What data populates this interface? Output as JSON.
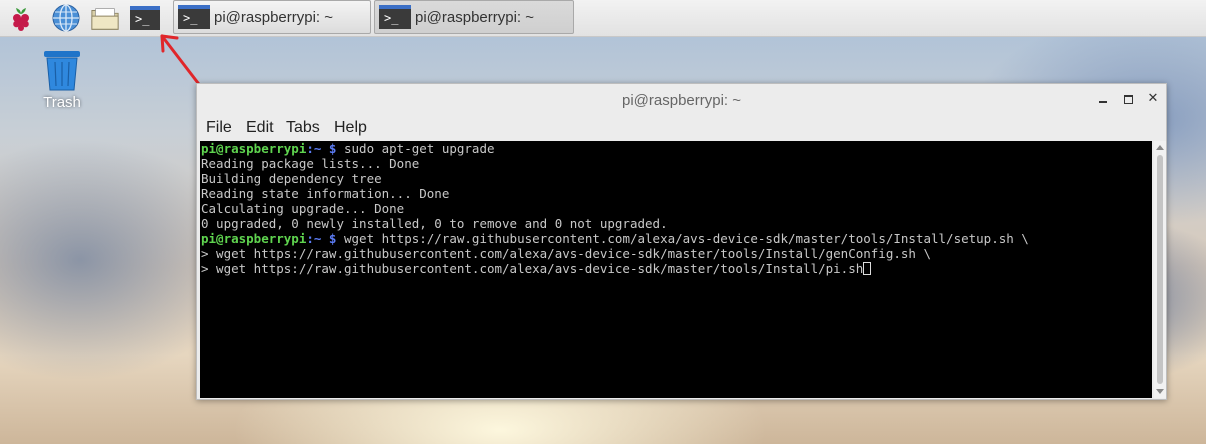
{
  "taskbar": {
    "icons": [
      "raspberry-menu-icon",
      "web-browser-icon",
      "file-manager-icon",
      "terminal-launcher-icon"
    ],
    "terminal_glyph": ">_",
    "windows": [
      {
        "label": "pi@raspberrypi: ~"
      },
      {
        "label": "pi@raspberrypi: ~"
      }
    ]
  },
  "desktop": {
    "trash_label": "Trash",
    "annotation": "red-arrow-pointing-to-terminal-launcher"
  },
  "window": {
    "title": "pi@raspberrypi: ~",
    "controls": {
      "minimize": "‗",
      "maximize": "▫",
      "close": "✕"
    },
    "menu": [
      "File",
      "Edit",
      "Tabs",
      "Help"
    ]
  },
  "terminal": {
    "prompt_user": "pi@raspberrypi",
    "prompt_path": ":~ $",
    "lines": [
      {
        "type": "prompt",
        "text": " sudo apt-get upgrade"
      },
      {
        "type": "output",
        "text": "Reading package lists... Done"
      },
      {
        "type": "output",
        "text": "Building dependency tree"
      },
      {
        "type": "output",
        "text": "Reading state information... Done"
      },
      {
        "type": "output",
        "text": "Calculating upgrade... Done"
      },
      {
        "type": "output",
        "text": "0 upgraded, 0 newly installed, 0 to remove and 0 not upgraded."
      },
      {
        "type": "prompt",
        "text": " wget https://raw.githubusercontent.com/alexa/avs-device-sdk/master/tools/Install/setup.sh \\"
      },
      {
        "type": "output",
        "text": "> wget https://raw.githubusercontent.com/alexa/avs-device-sdk/master/tools/Install/genConfig.sh \\"
      },
      {
        "type": "output",
        "text": "> wget https://raw.githubusercontent.com/alexa/avs-device-sdk/master/tools/Install/pi.sh"
      }
    ]
  },
  "colors": {
    "prompt_user": "#5fd44f",
    "prompt_path": "#5c7cf5",
    "terminal_bg": "#000000",
    "terminal_fg": "#c8c8c8",
    "annotation_arrow": "#e0262a"
  }
}
